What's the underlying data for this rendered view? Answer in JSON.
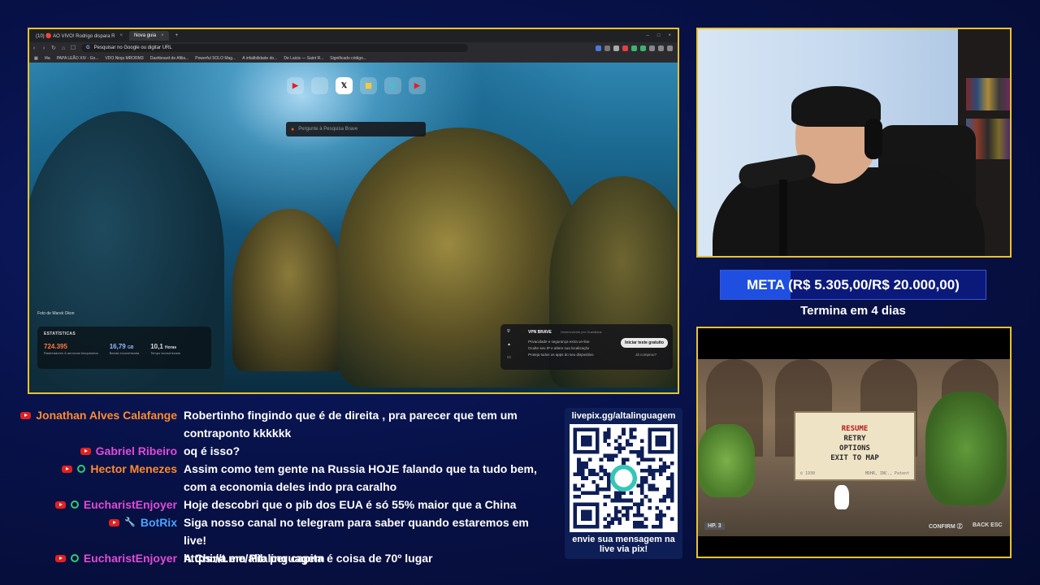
{
  "browser": {
    "tabs": [
      {
        "label": "(10) 🔴 AO VIVO! Rodrigo dispara R",
        "active": false
      },
      {
        "label": "Nova guia",
        "active": true
      }
    ],
    "address_placeholder": "Pesquisar no Google ou digitar URL",
    "bookmarks": [
      "I4a",
      "PAPA LEÃO XIV - Go...",
      "VDO.Ninja MRORM3",
      "Dashboard de Afilia...",
      "Powerful SOLO Mag...",
      "A infalibilidade do...",
      "De Laicis — Saint R...",
      "Significado código..."
    ],
    "newtab": {
      "topsites": [
        {
          "icon": "youtube-icon",
          "glyph": "▶",
          "color": "#e32020"
        },
        {
          "icon": "blank-site-icon",
          "glyph": "",
          "color": "#ffffff"
        },
        {
          "icon": "x-icon",
          "glyph": "𝕏",
          "color": "#000000"
        },
        {
          "icon": "news-icon",
          "glyph": "▦",
          "color": "#4a7ad8"
        },
        {
          "icon": "brave-talk-icon",
          "glyph": "◎",
          "color": "#36c6d8"
        },
        {
          "icon": "youtube-icon",
          "glyph": "▶",
          "color": "#e32020"
        }
      ],
      "search_placeholder": "Pergunte à Pesquisa Brave",
      "photo_credit": "Foto de Marek Okon",
      "stats": {
        "label": "ESTATÍSTICAS",
        "items": [
          {
            "value": "724.395",
            "unit": "",
            "sub": "Rastreadores & anúncios bloqueados",
            "color": "#ff7a3d"
          },
          {
            "value": "16,79",
            "unit": "GB",
            "sub": "Banda economizada",
            "color": "#9ab8ff"
          },
          {
            "value": "10,1",
            "unit": "Horas",
            "sub": "Tempo economizado",
            "color": "#ffffff"
          }
        ]
      },
      "vpn": {
        "title": "VPN BRAVE",
        "subtitle": "Desenvolvido por Guardians",
        "features": [
          "Privacidade e segurança extra on-line",
          "Oculte seu IP e altere sua localização",
          "Proteja todos os apps do seu dispositivo"
        ],
        "button": "Iniciar teste gratuito",
        "link": "Já comprou?"
      }
    }
  },
  "goal": {
    "text": "META (R$ 5.305,00/R$ 20.000,00)",
    "progress": 0.265,
    "ends": "Termina em 4 dias"
  },
  "game": {
    "options": [
      {
        "label": "RESUME",
        "selected": true
      },
      {
        "label": "RETRY",
        "selected": false
      },
      {
        "label": "OPTIONS",
        "selected": false
      },
      {
        "label": "EXIT TO MAP",
        "selected": false
      }
    ],
    "footer_left": "© 1930",
    "footer_right": "MDHR, INC., Patent",
    "hp": "HP. 3",
    "confirm": "CONFIRM Ⓩ",
    "back": "BACK ESC"
  },
  "chat": [
    {
      "author": "Jonathan Alves Calafange",
      "color": "#ff8a2e",
      "badges": [
        "yt"
      ],
      "lines": [
        "Robertinho fingindo que é de direita , pra parecer que tem um",
        "contraponto kkkkkk"
      ]
    },
    {
      "author": "Gabriel Ribeiro",
      "color": "#e04bd6",
      "badges": [
        "yt"
      ],
      "lines": [
        "oq é isso?"
      ]
    },
    {
      "author": "Hector Menezes",
      "color": "#ff8a2e",
      "badges": [
        "yt",
        "green"
      ],
      "lines": [
        "Assim como tem gente na Russia HOJE falando que ta tudo bem,",
        "com a economia deles indo pra caralho"
      ]
    },
    {
      "author": "EucharistEnjoyer",
      "color": "#e04bd6",
      "badges": [
        "yt",
        "green"
      ],
      "lines": [
        "Hoje descobri que o pib dos EUA é só 55% maior que a China"
      ]
    },
    {
      "author": "BotRix",
      "color": "#4aa3ff",
      "badges": [
        "yt",
        "wrench"
      ],
      "lines": [
        "Siga nosso canal no telegram para saber quando estaremos em live!",
        "https://t.me/altalinguagem"
      ]
    },
    {
      "author": "EucharistEnjoyer",
      "color": "#e04bd6",
      "badges": [
        "yt",
        "green"
      ],
      "lines": [
        "A China em Pib per capita é coisa de 70º lugar"
      ]
    }
  ],
  "pix": {
    "url": "livepix.gg/altalinguagem",
    "caption_1": "envie sua mensagem na",
    "caption_2": "live via pix!"
  }
}
